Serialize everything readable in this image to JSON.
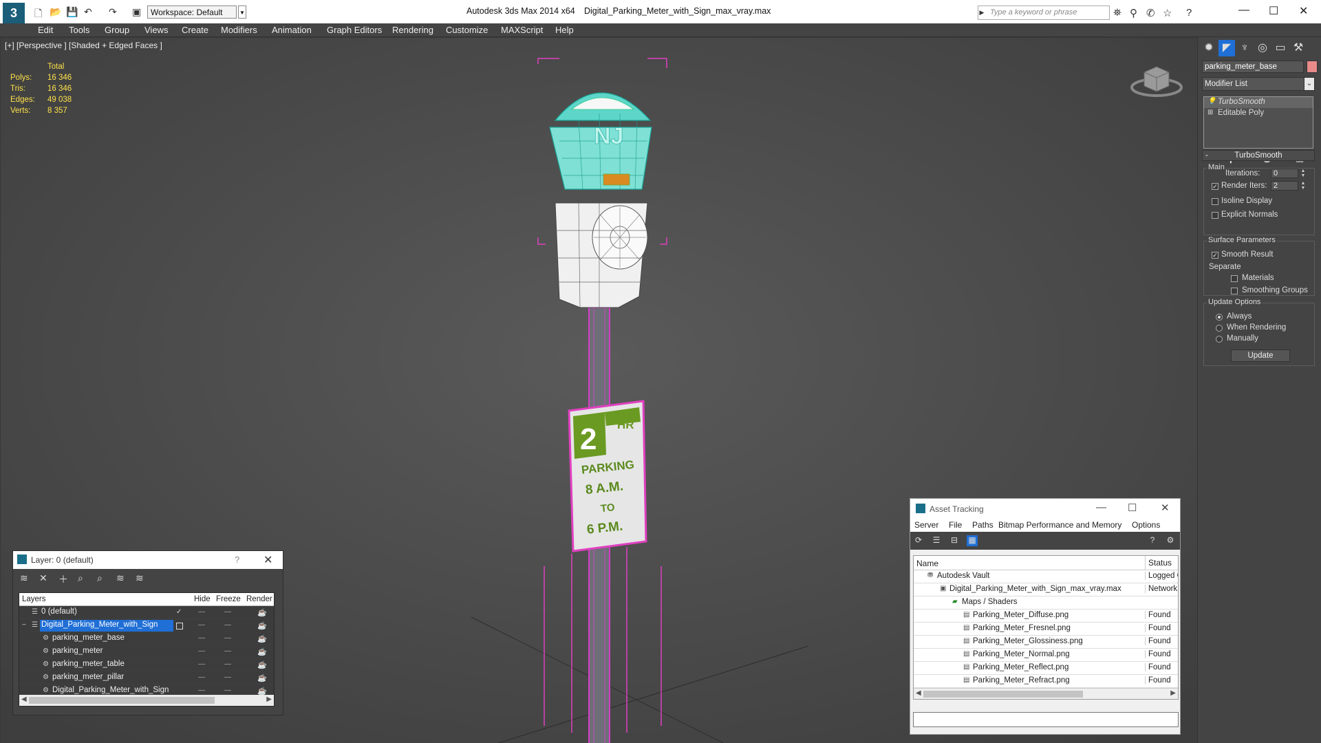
{
  "titlebar": {
    "workspace": "Workspace: Default",
    "app_title": "Autodesk 3ds Max  2014 x64",
    "file_title": "Digital_Parking_Meter_with_Sign_max_vray.max",
    "search_placeholder": "Type a keyword or phrase"
  },
  "menu": [
    "Edit",
    "Tools",
    "Group",
    "Views",
    "Create",
    "Modifiers",
    "Animation",
    "Graph Editors",
    "Rendering",
    "Customize",
    "MAXScript",
    "Help"
  ],
  "viewport": {
    "label": "[+] [Perspective ] [Shaded + Edged Faces ]",
    "stats": {
      "header": "Total",
      "rows": [
        {
          "k": "Polys:",
          "v": "16 346"
        },
        {
          "k": "Tris:",
          "v": "16 346"
        },
        {
          "k": "Edges:",
          "v": "49 038"
        },
        {
          "k": "Verts:",
          "v": "8 357"
        }
      ]
    },
    "sign": {
      "number": "2",
      "hr": "HR",
      "parking": "PARKING",
      "time1": "8 A.M.",
      "to": "TO",
      "time2": "6 P.M."
    },
    "meter_letters": "NJ"
  },
  "command_panel": {
    "object_name": "parking_meter_base",
    "object_color": "#e88a8a",
    "modifier_list": "Modifier List",
    "stack": [
      {
        "label": "TurboSmooth",
        "selected": true
      },
      {
        "label": "Editable Poly",
        "selected": false
      }
    ],
    "rollout_title": "TurboSmooth",
    "main_group": "Main",
    "iterations_label": "Iterations:",
    "iterations_value": "0",
    "render_iters_label": "Render Iters:",
    "render_iters_value": "2",
    "isoline_label": "Isoline Display",
    "explicit_normals_label": "Explicit Normals",
    "surface_group": "Surface Parameters",
    "smooth_result_label": "Smooth Result",
    "separate_label": "Separate",
    "materials_label": "Materials",
    "smoothing_groups_label": "Smoothing Groups",
    "update_group": "Update Options",
    "always_label": "Always",
    "when_rendering_label": "When Rendering",
    "manually_label": "Manually",
    "update_button": "Update"
  },
  "layer_window": {
    "title": "Layer: 0 (default)",
    "help": "?",
    "headers": {
      "layers": "Layers",
      "hide": "Hide",
      "freeze": "Freeze",
      "render": "Render"
    },
    "rows": [
      {
        "name": "0 (default)",
        "indent": 0,
        "checked": true,
        "selected": false
      },
      {
        "name": "Digital_Parking_Meter_with_Sign",
        "indent": 0,
        "checked": false,
        "selected": true
      },
      {
        "name": "parking_meter_base",
        "indent": 1,
        "checked": false,
        "selected": false
      },
      {
        "name": "parking_meter",
        "indent": 1,
        "checked": false,
        "selected": false
      },
      {
        "name": "parking_meter_table",
        "indent": 1,
        "checked": false,
        "selected": false
      },
      {
        "name": "parking_meter_pillar",
        "indent": 1,
        "checked": false,
        "selected": false
      },
      {
        "name": "Digital_Parking_Meter_with_Sign",
        "indent": 1,
        "checked": false,
        "selected": false
      }
    ]
  },
  "asset_window": {
    "title": "Asset Tracking",
    "menu": [
      "Server",
      "File",
      "Paths",
      "Bitmap Performance and Memory",
      "Options"
    ],
    "headers": {
      "name": "Name",
      "status": "Status"
    },
    "rows": [
      {
        "name": "Autodesk Vault",
        "status": "Logged Out",
        "indent": 1
      },
      {
        "name": "Digital_Parking_Meter_with_Sign_max_vray.max",
        "status": "Network",
        "indent": 2
      },
      {
        "name": "Maps / Shaders",
        "status": "",
        "indent": 3
      },
      {
        "name": "Parking_Meter_Diffuse.png",
        "status": "Found",
        "indent": 4
      },
      {
        "name": "Parking_Meter_Fresnel.png",
        "status": "Found",
        "indent": 4
      },
      {
        "name": "Parking_Meter_Glossiness.png",
        "status": "Found",
        "indent": 4
      },
      {
        "name": "Parking_Meter_Normal.png",
        "status": "Found",
        "indent": 4
      },
      {
        "name": "Parking_Meter_Reflect.png",
        "status": "Found",
        "indent": 4
      },
      {
        "name": "Parking_Meter_Refract.png",
        "status": "Found",
        "indent": 4
      }
    ]
  }
}
